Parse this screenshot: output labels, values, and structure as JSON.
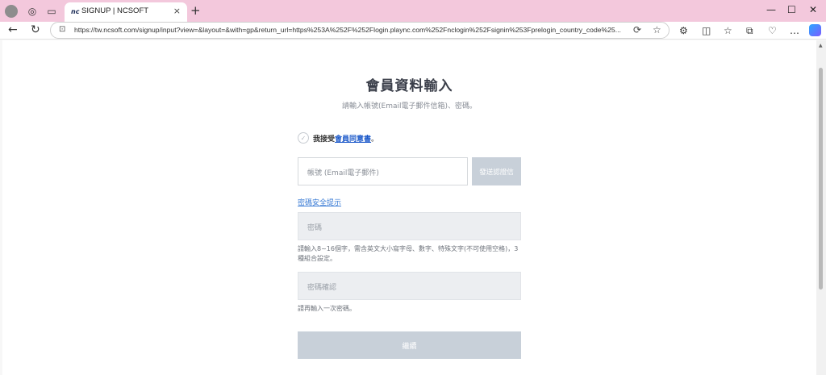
{
  "browser": {
    "tab_title": "SIGNUP | NCSOFT",
    "tab_favicon": "nc",
    "url": "https://tw.ncsoft.com/signup/input?view=&layout=&with=gp&return_url=https%253A%252F%252Flogin.plaync.com%252Fnclogin%252Fsignin%253Fprelogin_country_code%25...",
    "icons": {
      "tab_close": "×",
      "new_tab": "+",
      "minimize": "—",
      "maximize": "☐",
      "close": "✕",
      "back": "←",
      "refresh": "↻",
      "lock": "🔒",
      "translate": "⟳",
      "favorite": "☆",
      "extensions": "⚙",
      "split": "◫",
      "favorites_bar": "☆",
      "collections": "⧉",
      "shield": "♥",
      "more": "…"
    }
  },
  "form": {
    "title": "會員資料輸入",
    "subtitle": "請輸入帳號(Email電子郵件信箱)、密碼。",
    "agree_prefix": "我接受",
    "agree_link": "會員同意書",
    "agree_suffix": "。",
    "check_glyph": "✓",
    "account_placeholder": "帳號 (Email電子郵件)",
    "send_button": "發送認證信",
    "password_hint_link": "密碼安全提示",
    "password_placeholder": "密碼",
    "password_help": "請輸入8~16個字，需含英文大小寫字母、數字、特殊文字(不可使用空格)，3種組合設定。",
    "confirm_placeholder": "密碼確認",
    "confirm_help": "請再輸入一次密碼。",
    "continue_button": "繼續"
  }
}
